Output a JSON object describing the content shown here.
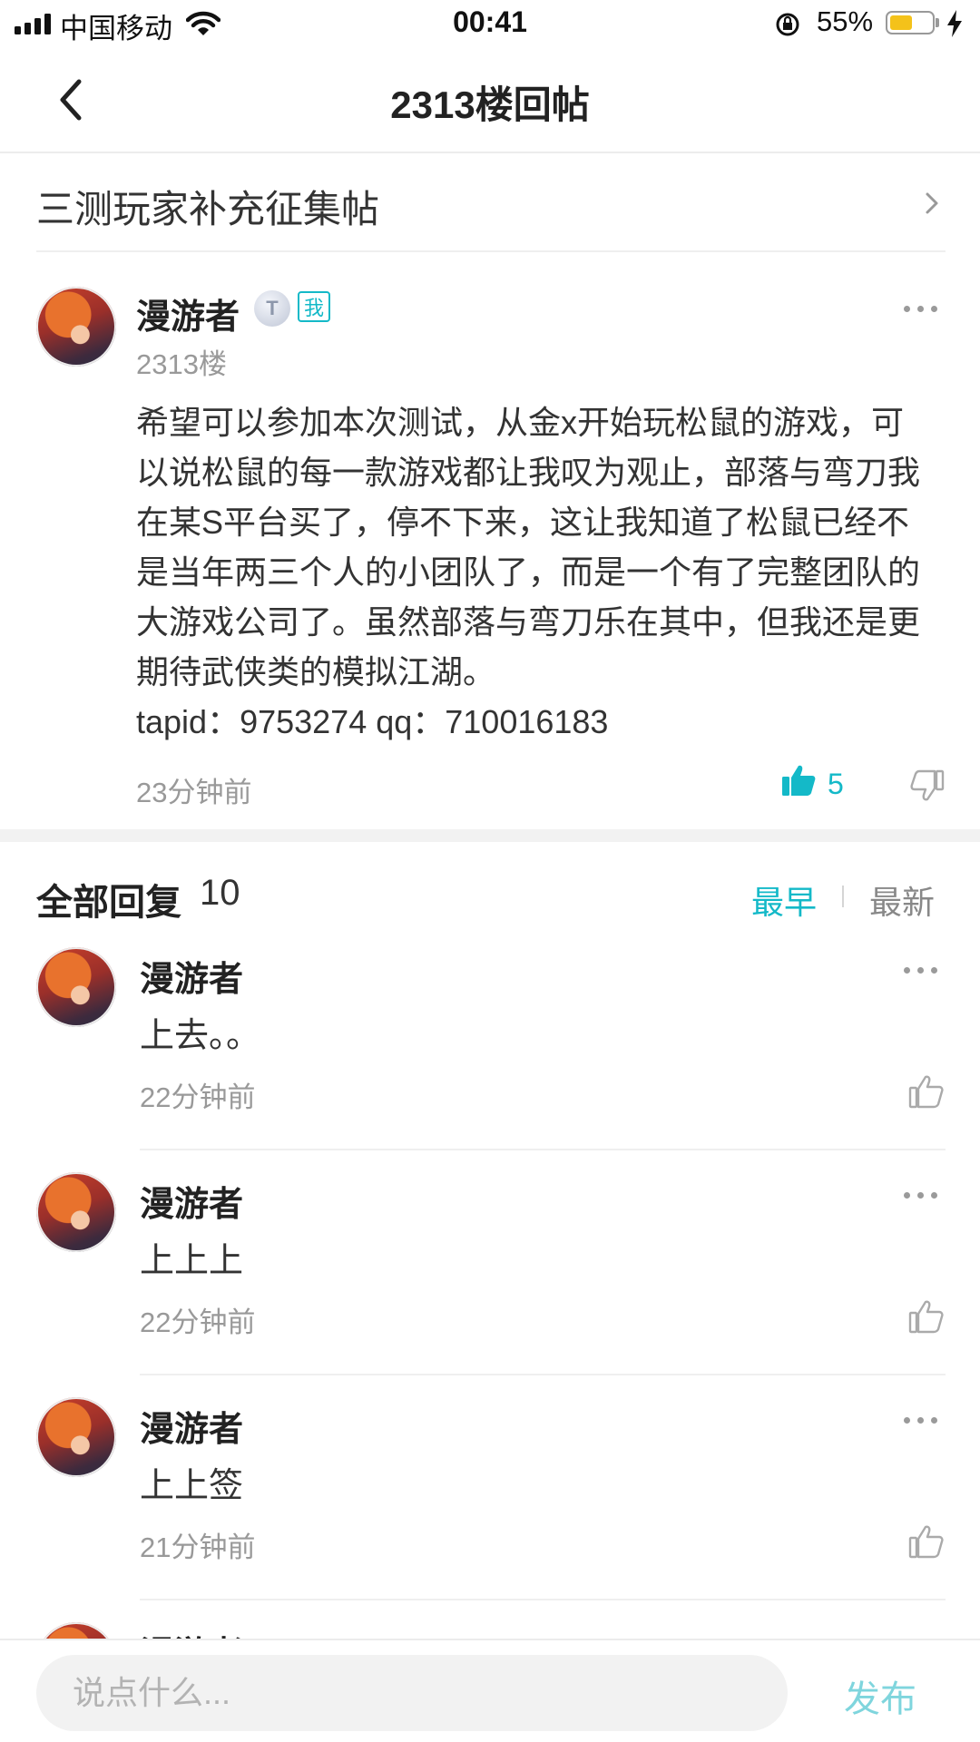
{
  "status_bar": {
    "carrier": "中国移动",
    "time": "00:41",
    "battery_percent": "55%",
    "battery_level": 0.55,
    "battery_color": "#f4c21a"
  },
  "nav": {
    "back_icon": "chevron-left-icon",
    "title": "2313楼回帖"
  },
  "thread_link": {
    "label": "三测玩家补充征集帖",
    "icon": "chevron-right-icon"
  },
  "post": {
    "author": "漫游者",
    "level_badge": "T",
    "me_badge": "我",
    "floor": "2313楼",
    "content": "希望可以参加本次测试，从金x开始玩松鼠的游戏，可以说松鼠的每一款游戏都让我叹为观止，部落与弯刀我在某S平台买了，停不下来，这让我知道了松鼠已经不是当年两三个人的小团队了，而是一个有了完整团队的大游戏公司了。虽然部落与弯刀乐在其中，但我还是更期待武侠类的模拟江湖。",
    "content_ids": "tapid：9753274 qq：710016183",
    "time": "23分钟前",
    "likes": "5"
  },
  "replies_header": {
    "title": "全部回复",
    "count": "10",
    "sort_earliest": "最早",
    "sort_latest": "最新"
  },
  "replies": [
    {
      "author": "漫游者",
      "content": "上去。。",
      "time": "22分钟前"
    },
    {
      "author": "漫游者",
      "content": "上上上",
      "time": "22分钟前"
    },
    {
      "author": "漫游者",
      "content": "上上签",
      "time": "21分钟前"
    },
    {
      "author": "漫游者"
    }
  ],
  "input_bar": {
    "placeholder": "说点什么...",
    "publish_label": "发布"
  },
  "colors": {
    "accent": "#14b9c8",
    "publish_disabled": "#7fd5dd"
  }
}
